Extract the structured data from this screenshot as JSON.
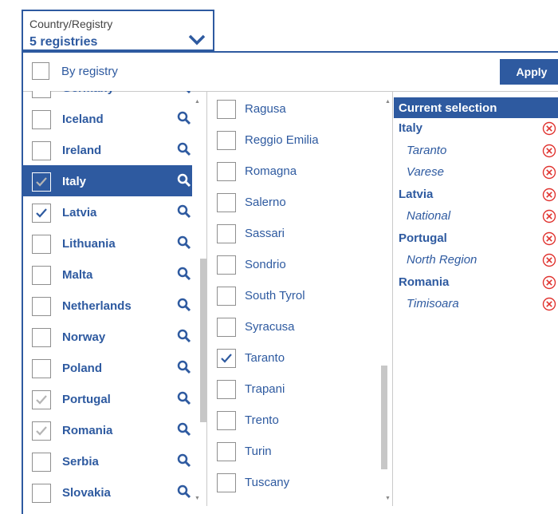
{
  "dropdown": {
    "caption": "Country/Registry",
    "value": "5 registries"
  },
  "filter": {
    "by_registry_label": "By registry",
    "apply_label": "Apply"
  },
  "countries": [
    {
      "label": "Germany",
      "state": "unchecked"
    },
    {
      "label": "Iceland",
      "state": "unchecked"
    },
    {
      "label": "Ireland",
      "state": "unchecked"
    },
    {
      "label": "Italy",
      "state": "partial",
      "selected": true
    },
    {
      "label": "Latvia",
      "state": "checked"
    },
    {
      "label": "Lithuania",
      "state": "unchecked"
    },
    {
      "label": "Malta",
      "state": "unchecked"
    },
    {
      "label": "Netherlands",
      "state": "unchecked"
    },
    {
      "label": "Norway",
      "state": "unchecked"
    },
    {
      "label": "Poland",
      "state": "unchecked"
    },
    {
      "label": "Portugal",
      "state": "partial"
    },
    {
      "label": "Romania",
      "state": "partial"
    },
    {
      "label": "Serbia",
      "state": "unchecked"
    },
    {
      "label": "Slovakia",
      "state": "unchecked"
    }
  ],
  "registries": [
    {
      "label": "Ragusa",
      "checked": false
    },
    {
      "label": "Reggio Emilia",
      "checked": false
    },
    {
      "label": "Romagna",
      "checked": false
    },
    {
      "label": "Salerno",
      "checked": false
    },
    {
      "label": "Sassari",
      "checked": false
    },
    {
      "label": "Sondrio",
      "checked": false
    },
    {
      "label": "South Tyrol",
      "checked": false
    },
    {
      "label": "Syracusa",
      "checked": false
    },
    {
      "label": "Taranto",
      "checked": true
    },
    {
      "label": "Trapani",
      "checked": false
    },
    {
      "label": "Trento",
      "checked": false
    },
    {
      "label": "Turin",
      "checked": false
    },
    {
      "label": "Tuscany",
      "checked": false
    }
  ],
  "current_selection": {
    "title": "Current selection",
    "items": [
      {
        "type": "country",
        "label": "Italy"
      },
      {
        "type": "region",
        "label": "Taranto"
      },
      {
        "type": "region",
        "label": "Varese"
      },
      {
        "type": "country",
        "label": "Latvia"
      },
      {
        "type": "region",
        "label": "National"
      },
      {
        "type": "country",
        "label": "Portugal"
      },
      {
        "type": "region",
        "label": "North Region"
      },
      {
        "type": "country",
        "label": "Romania"
      },
      {
        "type": "region",
        "label": "Timisoara"
      }
    ]
  },
  "icons": {
    "dropdown": "chevron-down-icon",
    "search": "search-icon",
    "remove": "remove-circle-icon",
    "check": "check-icon"
  },
  "colors": {
    "accent": "#2e5aa0",
    "remove": "#e0332f",
    "check": "#2e5aa0",
    "partial_check": "#b5b5b5"
  }
}
